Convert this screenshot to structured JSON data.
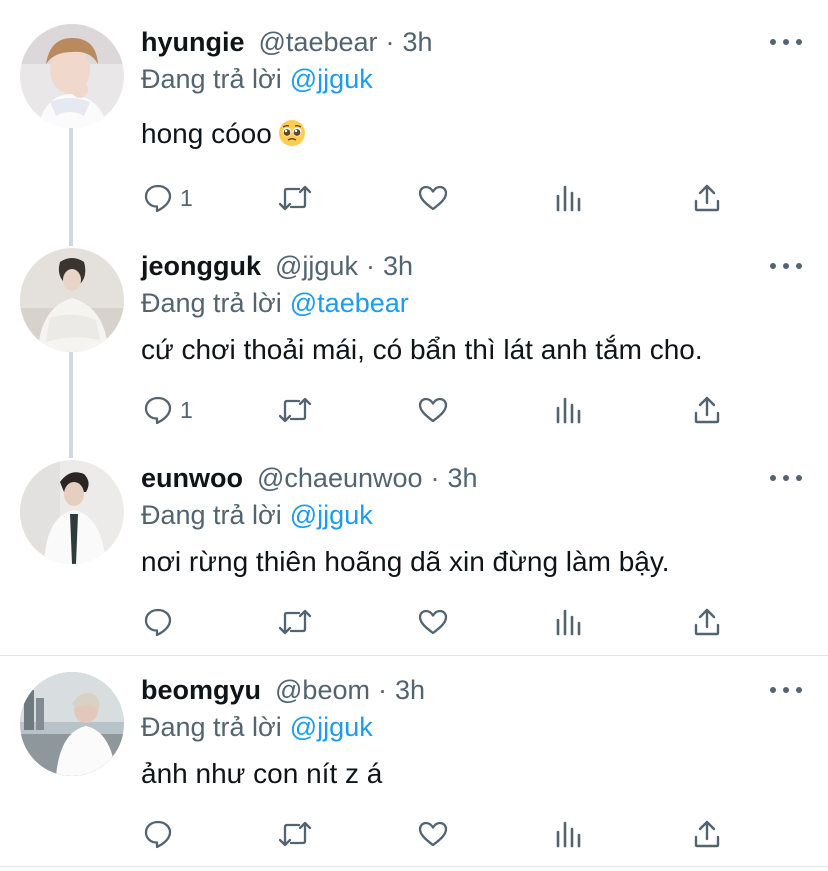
{
  "tweets": [
    {
      "display_name": "hyungie",
      "handle": "@taebear",
      "time": "3h",
      "reply_prefix": "Đang trả lời",
      "reply_to": "@jjguk",
      "text": "hong cóoo",
      "emoji": "pleading-face-emoji",
      "reply_count": "1"
    },
    {
      "display_name": "jeongguk",
      "handle": "@jjguk",
      "time": "3h",
      "reply_prefix": "Đang trả lời",
      "reply_to": "@taebear",
      "text": "cứ chơi thoải mái, có bẩn thì lát anh tắm cho.",
      "reply_count": "1"
    },
    {
      "display_name": "eunwoo",
      "handle": "@chaeunwoo",
      "time": "3h",
      "reply_prefix": "Đang trả lời",
      "reply_to": "@jjguk",
      "text": "nơi rừng thiên hoãng dã xin đừng làm bậy.",
      "reply_count": ""
    },
    {
      "display_name": "beomgyu",
      "handle": "@beom",
      "time": "3h",
      "reply_prefix": "Đang trả lời",
      "reply_to": "@jjguk",
      "text": "ảnh như con nít z á",
      "reply_count": ""
    }
  ],
  "icons": {
    "reply": "reply-icon",
    "retweet": "retweet-icon",
    "like": "heart-icon",
    "views": "analytics-icon",
    "share": "share-icon",
    "more": "more-icon"
  },
  "colors": {
    "text": "#0f1419",
    "secondary": "#536471",
    "mention": "#1d9bf0",
    "thread_line": "#cfd9de",
    "divider": "#e1e5e8"
  }
}
